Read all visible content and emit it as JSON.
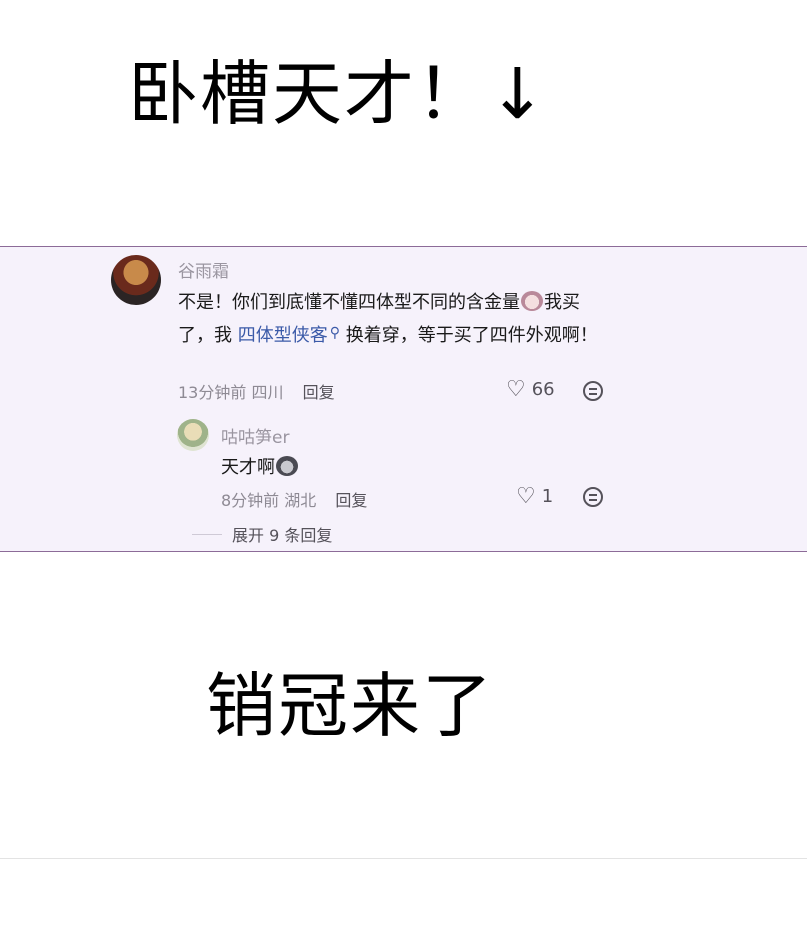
{
  "top_caption": "卧槽天才！↓",
  "bottom_caption": "销冠来了",
  "comment": {
    "username": "谷雨霜",
    "text_part1": "不是！你们到底懂不懂四体型不同的含金量",
    "text_part2": "我买了，我 ",
    "topic": "四体型侠客",
    "text_part3": " 换着穿，等于买了四件外观啊！",
    "time": "13分钟前",
    "location": "四川",
    "reply_label": "回复",
    "likes": "66"
  },
  "reply": {
    "username": "咕咕笋er",
    "text": "天才啊",
    "time": "8分钟前",
    "location": "湖北",
    "reply_label": "回复",
    "likes": "1"
  },
  "expand_replies": "展开 9 条回复",
  "icons": {
    "like": "heart-icon",
    "emoji": "emoji-face-icon",
    "topic": "search-topic-icon"
  },
  "colors": {
    "panel_bg": "#f6f2fb",
    "topic_link": "#3b5aa8",
    "muted_text": "#9a95a0"
  }
}
